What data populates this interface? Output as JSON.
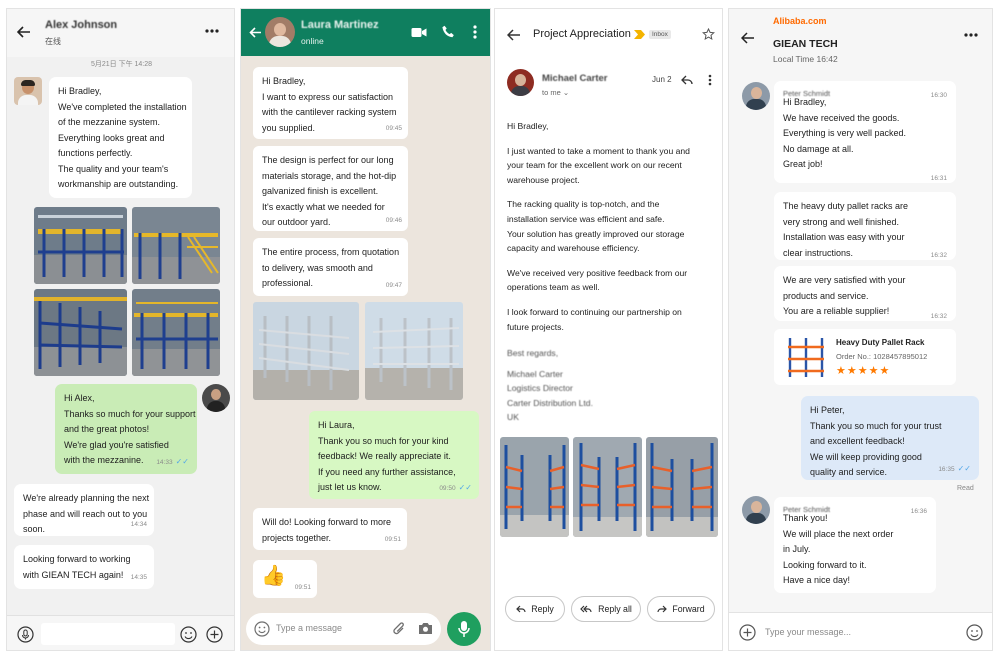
{
  "colors": {
    "whatsapp_header": "#0f7f5f",
    "whatsapp_green": "#1f9f5f",
    "wechat_out": "#c9ecb6",
    "whatsapp_out": "#d7f8c3",
    "alibaba_orange": "#ff6a00",
    "alibaba_out": "#dde9f8",
    "read_ticks": "#53a7e8",
    "star": "#ff7a00"
  },
  "wechat": {
    "contact_name": "Alex Johnson",
    "status": "在线",
    "date_divider": "5月21日 下午 14:28",
    "messages": [
      {
        "lines": [
          "Hi Bradley,",
          "We've completed the installation",
          "of the mezzanine system.",
          "Everything looks great and",
          "functions perfectly.",
          "The quality and your team's",
          "workmanship are outstanding."
        ]
      },
      {
        "lines": [
          "Hi Alex,",
          "Thanks so much for your support",
          "and the great photos!",
          "We're glad you're satisfied",
          "with the mezzanine."
        ],
        "time": "14:33"
      },
      {
        "lines": [
          "We're already planning the next",
          "phase and will reach out to you",
          "soon."
        ],
        "time": "14:34"
      },
      {
        "lines": [
          "Looking forward to working",
          "with GIEAN TECH again!"
        ],
        "time": "14:35"
      }
    ]
  },
  "whatsapp": {
    "contact_name": "Laura Martinez",
    "status": "online",
    "input_placeholder": "Type a message",
    "messages": [
      {
        "lines": [
          "Hi Bradley,",
          "I want to express our satisfaction",
          "with the cantilever racking system",
          "you supplied."
        ],
        "time": "09:45"
      },
      {
        "lines": [
          "The design is perfect for our long",
          "materials storage, and the hot-dip",
          "galvanized finish is excellent.",
          "It's exactly what we needed for",
          "our outdoor yard."
        ],
        "time": "09:46"
      },
      {
        "lines": [
          "The entire process, from quotation",
          "to delivery, was smooth and",
          "professional."
        ],
        "time": "09:47"
      },
      {
        "lines": [
          "Hi Laura,",
          "Thank you so much for your kind",
          "feedback! We really appreciate it.",
          "If you need any further assistance,",
          "just let us know."
        ],
        "time": "09:50"
      },
      {
        "lines": [
          "Will do! Looking forward to more",
          "projects together."
        ],
        "time": "09:51"
      },
      {
        "emoji": "👍",
        "time": "09:51"
      }
    ]
  },
  "gmail": {
    "subject": "Project Appreciation",
    "label": "Inbox",
    "sender": "Michael Carter",
    "date": "Jun 2",
    "to": "to me",
    "body": [
      [
        "Hi Bradley,"
      ],
      [
        "I just wanted to take a moment to thank you and",
        "your team for the excellent work on our recent",
        "warehouse project."
      ],
      [
        "The racking quality is top-notch, and the",
        "installation service was efficient and safe.",
        "Your solution has greatly improved our storage",
        "capacity and warehouse efficiency."
      ],
      [
        "We've received very positive feedback from our",
        "operations team as well."
      ],
      [
        "I look forward to continuing our partnership on",
        "future projects."
      ]
    ],
    "closing": "Best regards,",
    "signature": [
      "Michael Carter",
      "Logistics Director",
      "Carter Distribution Ltd.",
      "UK"
    ],
    "buttons": {
      "reply": "Reply",
      "reply_all": "Reply all",
      "forward": "Forward"
    }
  },
  "alibaba": {
    "brand": "Alibaba.com",
    "company": "GIEAN TECH",
    "local_time": "Local Time 16:42",
    "input_placeholder": "Type your message...",
    "sender": "Peter Schmidt",
    "messages": [
      {
        "lines": [
          "Hi Bradley,",
          "We have received the goods.",
          "Everything is very well packed.",
          "No damage at all.",
          "Great job!"
        ],
        "time_top": "16:30",
        "time": "16:31"
      },
      {
        "lines": [
          "The heavy duty pallet racks are",
          "very strong and well finished.",
          "Installation was easy with your",
          "clear instructions."
        ],
        "time": "16:32"
      },
      {
        "lines": [
          "We are very satisfied with your",
          "products and service.",
          "You are a reliable supplier!"
        ],
        "time": "16:32"
      },
      {
        "lines": [
          "Hi Peter,",
          "Thank you so much for your trust",
          "and excellent feedback!",
          "We will keep providing good",
          "quality and service."
        ],
        "time": "16:35",
        "status": "Read"
      },
      {
        "lines": [
          "Thank you!",
          "We will place the next order",
          "in July.",
          "Looking forward to it.",
          "Have a nice day!"
        ],
        "time_top": "16:36"
      }
    ],
    "product": {
      "name": "Heavy Duty Pallet Rack",
      "order": "Order No.: 1028457895012",
      "rating": 5,
      "stars": "★★★★★"
    }
  }
}
